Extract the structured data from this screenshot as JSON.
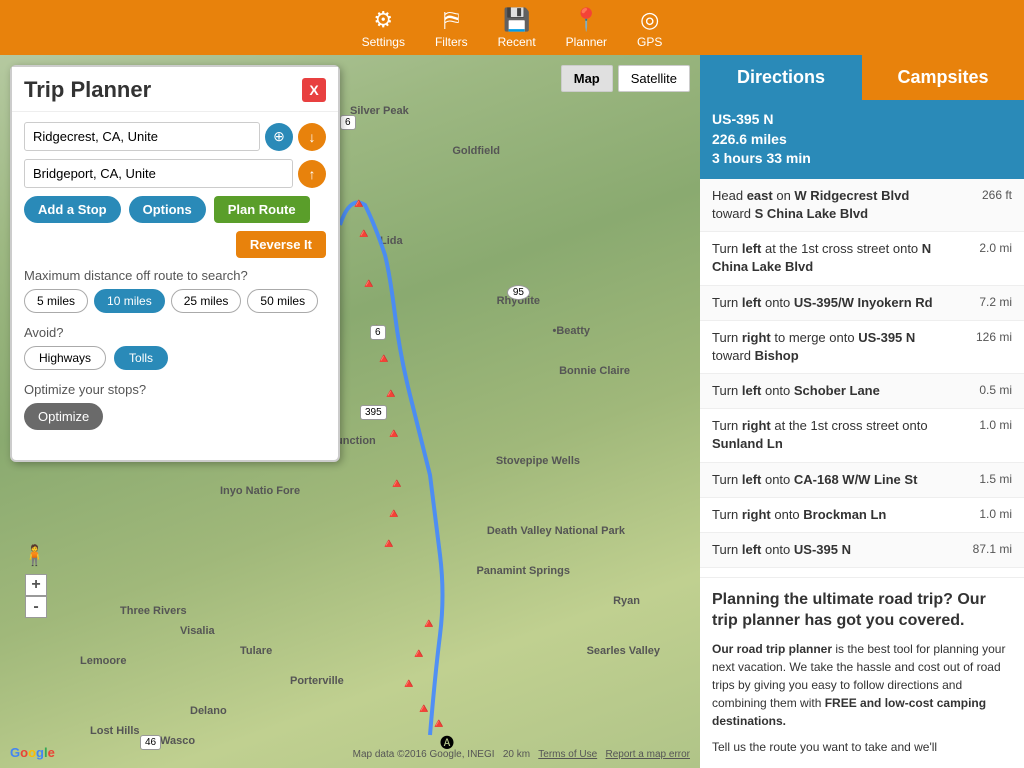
{
  "toolbar": {
    "title": "Trip Planner",
    "items": [
      {
        "label": "Settings",
        "icon": "⚙"
      },
      {
        "label": "Filters",
        "icon": "⛿"
      },
      {
        "label": "Recent",
        "icon": "💾"
      },
      {
        "label": "Planner",
        "icon": "📍"
      },
      {
        "label": "GPS",
        "icon": "◎"
      }
    ]
  },
  "planner": {
    "title": "Trip Planner",
    "close_label": "X",
    "origin": "Ridgecrest, CA, Unite",
    "destination": "Bridgeport, CA, Unite",
    "add_stop_label": "Add a Stop",
    "options_label": "Options",
    "plan_route_label": "Plan Route",
    "reverse_label": "Reverse It",
    "distance_section": "Maximum distance off route to search?",
    "distance_options": [
      "5 miles",
      "10 miles",
      "25 miles",
      "50 miles"
    ],
    "active_distance": "10 miles",
    "avoid_label": "Avoid?",
    "avoid_options": [
      "Highways",
      "Tolls"
    ],
    "active_avoids": [
      "Tolls"
    ],
    "optimize_label": "Optimize your stops?",
    "optimize_btn": "Optimize"
  },
  "map": {
    "map_btn": "Map",
    "satellite_btn": "Satellite",
    "zoom_in": "+",
    "zoom_out": "-",
    "attribution": "Map data ©2016 Google, INEGI",
    "scale": "20 km",
    "google_text": "Google",
    "terms": "Terms of Use",
    "report": "Report a map error"
  },
  "tabs": [
    {
      "label": "Directions",
      "active": true
    },
    {
      "label": "Campsites",
      "active": false
    }
  ],
  "route_summary": {
    "highway": "US-395 N",
    "distance": "226.6 miles",
    "duration": "3 hours 33 min"
  },
  "directions": [
    {
      "text": "Head <strong>east</strong> on <strong>W Ridgecrest Blvd</strong> toward <strong>S China Lake Blvd</strong>",
      "dist": "266 ft"
    },
    {
      "text": "Turn <strong>left</strong> at the 1st cross street onto <strong>N China Lake Blvd</strong>",
      "dist": "2.0 mi"
    },
    {
      "text": "Turn <strong>left</strong> onto <strong>US-395/W Inyokern Rd</strong>",
      "dist": "7.2 mi"
    },
    {
      "text": "Turn <strong>right</strong> to merge onto <strong>US-395 N</strong> toward <strong>Bishop</strong>",
      "dist": "126 mi"
    },
    {
      "text": "Turn <strong>left</strong> onto <strong>Schober Lane</strong>",
      "dist": "0.5 mi"
    },
    {
      "text": "Turn <strong>right</strong> at the 1st cross street onto <strong>Sunland Ln</strong>",
      "dist": "1.0 mi"
    },
    {
      "text": "Turn <strong>left</strong> onto <strong>CA-168 W/W Line St</strong>",
      "dist": "1.5 mi"
    },
    {
      "text": "Turn <strong>right</strong> onto <strong>Brockman Ln</strong>",
      "dist": "1.0 mi"
    },
    {
      "text": "Turn <strong>left</strong> onto <strong>US-395 N</strong>",
      "dist": "87.1 mi"
    }
  ],
  "promo": {
    "heading": "Planning the ultimate road trip? Our trip planner has got you covered.",
    "body_start": "Our road trip planner",
    "body_mid": " is the best tool for planning your next vacation. We take the hassle and cost out of road trips by giving you easy to follow directions and combining them with ",
    "body_free": "FREE and low-cost camping destinations.",
    "body_end": "\n\nTell us the route you want to take and we'll"
  }
}
